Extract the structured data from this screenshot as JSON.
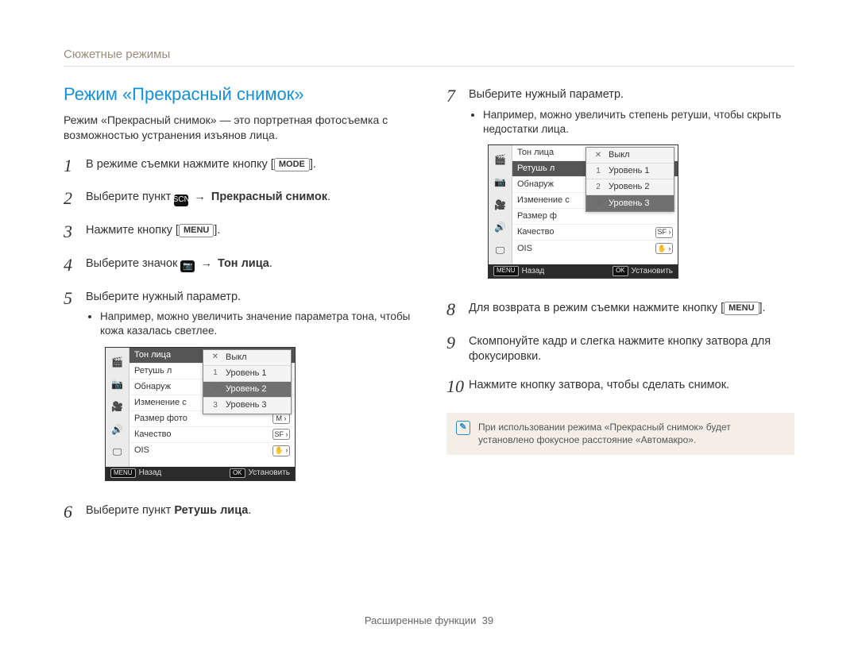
{
  "breadcrumb": "Сюжетные режимы",
  "section_title": "Режим «Прекрасный снимок»",
  "intro": "Режим «Прекрасный снимок» — это портретная фотосъемка с возможностью устранения изъянов лица.",
  "badges": {
    "mode": "MODE",
    "menu": "MENU",
    "scn_text": "SCN",
    "ok": "OK"
  },
  "steps": {
    "s1_pre": "В режиме съемки нажмите кнопку [",
    "s1_post": "].",
    "s2_pre": "Выберите пункт ",
    "s2_mid": " → ",
    "s2_bold": "Прекрасный снимок",
    "s2_post": ".",
    "s3_pre": "Нажмите кнопку [",
    "s3_post": "].",
    "s4_pre": "Выберите значок ",
    "s4_mid": " → ",
    "s4_bold": "Тон лица",
    "s4_post": ".",
    "s5": "Выберите нужный параметр.",
    "s5_sub": "Например, можно увеличить значение параметра тона, чтобы кожа казалась светлее.",
    "s6_pre": "Выберите пункт ",
    "s6_bold": "Ретушь лица",
    "s6_post": ".",
    "s7": "Выберите нужный параметр.",
    "s7_sub": "Например, можно увеличить степень ретуши, чтобы скрыть недостатки лица.",
    "s8_pre": "Для возврата в режим съемки нажмите кнопку [",
    "s8_post": "].",
    "s9": "Скомпонуйте кадр и слегка нажмите кнопку затвора для фокусировки.",
    "s10": "Нажмите кнопку затвора, чтобы сделать снимок."
  },
  "lcd1": {
    "rows": [
      {
        "label": "Тон лица"
      },
      {
        "label": "Ретушь л"
      },
      {
        "label": "Обнаруж"
      },
      {
        "label": "Изменение с"
      },
      {
        "label": "Размер фото"
      },
      {
        "label": "Качество"
      },
      {
        "label": "OIS"
      }
    ],
    "suffix1": "M ›",
    "suffix2": "SF ›",
    "suffix3": "✋ ›",
    "popup": [
      {
        "label": "Выкл",
        "icon": "✕"
      },
      {
        "label": "Уровень 1",
        "icon": "1"
      },
      {
        "label": "Уровень 2",
        "icon": "2"
      },
      {
        "label": "Уровень 3",
        "icon": "3"
      }
    ],
    "popup_sel_index": 2,
    "footer_back": "Назад",
    "footer_set": "Установить"
  },
  "lcd2": {
    "rows": [
      {
        "label": "Тон лица"
      },
      {
        "label": "Ретушь л"
      },
      {
        "label": "Обнаруж"
      },
      {
        "label": "Изменение с"
      },
      {
        "label": "Размер ф"
      },
      {
        "label": "Качество"
      },
      {
        "label": "OIS"
      }
    ],
    "suffix1": "SF ›",
    "suffix2": "✋ ›",
    "popup": [
      {
        "label": "Выкл",
        "icon": "✕"
      },
      {
        "label": "Уровень 1",
        "icon": "1"
      },
      {
        "label": "Уровень 2",
        "icon": "2"
      },
      {
        "label": "Уровень 3",
        "icon": "3"
      }
    ],
    "popup_sel_index": 3,
    "footer_back": "Назад",
    "footer_set": "Установить"
  },
  "note": "При использовании режима «Прекрасный снимок» будет установлено фокусное расстояние «Автомакро».",
  "footer": {
    "section": "Расширенные функции",
    "page": "39"
  }
}
